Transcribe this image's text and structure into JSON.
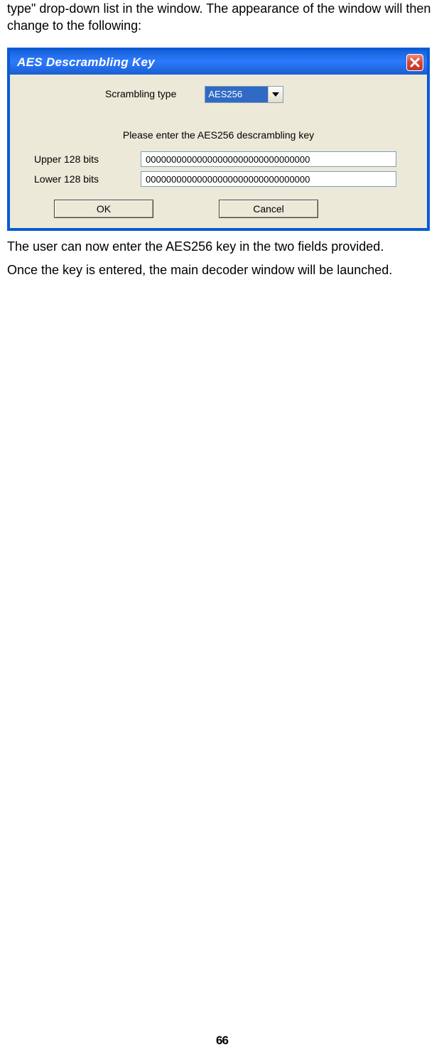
{
  "doc": {
    "intro": "type\" drop-down list in the window. The appearance of the window will then change to the following:",
    "after1": "The user can now enter the AES256 key in the two fields provided.",
    "after2": "Once the key is entered, the main decoder window will be launched.",
    "pagenum": "66"
  },
  "window": {
    "title": "AES Descrambling Key",
    "scrambling_label": "Scrambling type",
    "scrambling_value": "AES256",
    "instruction": "Please enter the AES256 descrambling key",
    "upper_label": "Upper 128 bits",
    "lower_label": "Lower 128 bits",
    "upper_value": "00000000000000000000000000000000",
    "lower_value": "00000000000000000000000000000000",
    "ok": "OK",
    "cancel": "Cancel"
  }
}
